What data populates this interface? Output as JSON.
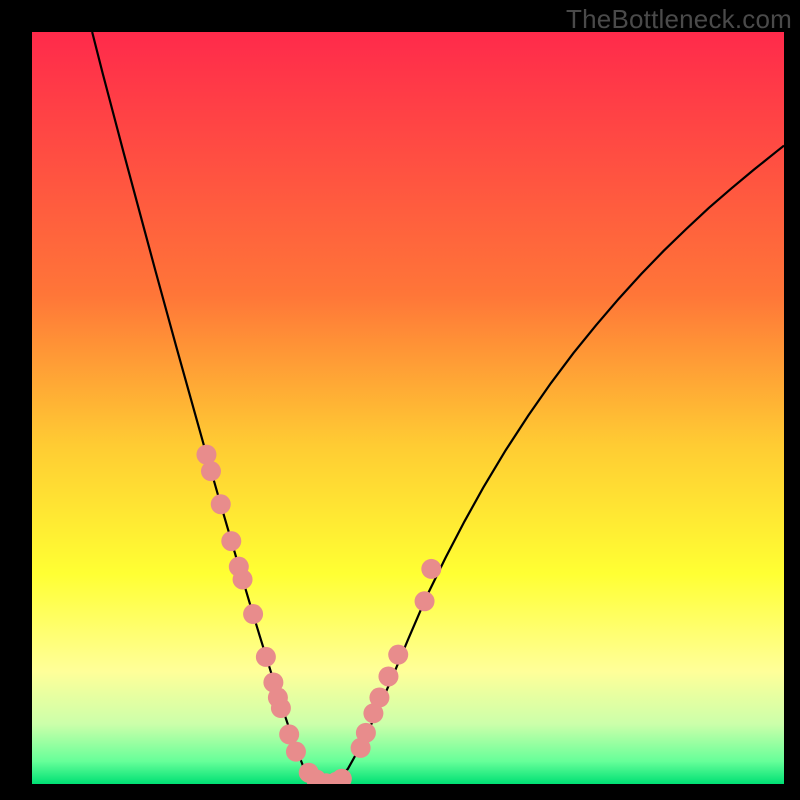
{
  "watermark": {
    "text": "TheBottleneck.com"
  },
  "chart_data": {
    "type": "line",
    "title": "",
    "xlabel": "",
    "ylabel": "",
    "xlim": [
      0,
      100
    ],
    "ylim": [
      0,
      100
    ],
    "background_gradient": {
      "orientation": "vertical",
      "stops": [
        {
          "offset": 0.0,
          "color": "#FF2A4B"
        },
        {
          "offset": 0.35,
          "color": "#FF7638"
        },
        {
          "offset": 0.55,
          "color": "#FFCC33"
        },
        {
          "offset": 0.72,
          "color": "#FFFF33"
        },
        {
          "offset": 0.85,
          "color": "#FFFF99"
        },
        {
          "offset": 0.92,
          "color": "#CCFFAA"
        },
        {
          "offset": 0.97,
          "color": "#66FF99"
        },
        {
          "offset": 1.0,
          "color": "#00E074"
        }
      ]
    },
    "series": [
      {
        "name": "bottleneck-curve",
        "color": "#000000",
        "x": [
          8.0,
          9.4,
          10.8,
          12.2,
          13.6,
          15.0,
          16.4,
          17.8,
          19.2,
          20.6,
          22.0,
          23.4,
          24.8,
          26.2,
          27.6,
          29.0,
          30.4,
          31.8,
          33.2,
          34.6,
          36.0,
          37.0,
          38.0,
          39.0,
          40.0,
          42.0,
          44.0,
          46.0,
          48.0,
          50.0,
          52.5,
          55.0,
          57.5,
          60.0,
          63.0,
          66.0,
          69.0,
          72.0,
          75.0,
          78.0,
          81.0,
          84.0,
          87.0,
          90.0,
          93.0,
          96.0,
          99.0,
          100.0
        ],
        "values": [
          100.0,
          94.5,
          89.2,
          83.9,
          78.7,
          73.5,
          68.3,
          63.2,
          58.1,
          53.1,
          48.1,
          43.1,
          38.2,
          33.4,
          28.6,
          23.9,
          19.3,
          14.8,
          10.4,
          6.2,
          2.5,
          1.2,
          0.4,
          0.1,
          0.0,
          2.0,
          5.6,
          9.8,
          14.4,
          19.2,
          25.0,
          30.1,
          34.9,
          39.4,
          44.4,
          49.0,
          53.3,
          57.3,
          61.0,
          64.5,
          67.8,
          70.9,
          73.8,
          76.6,
          79.2,
          81.7,
          84.1,
          84.9
        ]
      }
    ],
    "markers": [
      {
        "name": "data-points",
        "color": "#E88C8C",
        "radius": 10,
        "shape": "circle",
        "x": [
          23.2,
          23.8,
          25.1,
          26.5,
          27.5,
          28.0,
          29.4,
          31.1,
          32.1,
          32.7,
          33.1,
          34.2,
          35.1,
          36.8,
          37.8,
          39.1,
          40.5,
          41.2,
          43.7,
          44.4,
          45.4,
          46.2,
          47.4,
          48.7,
          52.2,
          53.1
        ],
        "y": [
          43.8,
          41.6,
          37.2,
          32.3,
          28.9,
          27.2,
          22.6,
          16.9,
          13.5,
          11.5,
          10.1,
          6.6,
          4.3,
          1.5,
          0.6,
          0.1,
          0.3,
          0.7,
          4.8,
          6.8,
          9.4,
          11.5,
          14.3,
          17.2,
          24.3,
          28.6
        ]
      }
    ]
  }
}
